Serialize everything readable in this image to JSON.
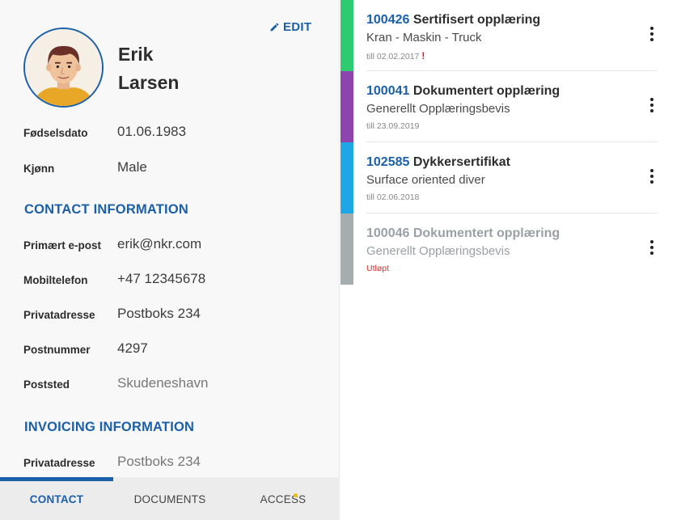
{
  "profile": {
    "edit_label": "EDIT",
    "first_name": "Erik",
    "last_name": "Larsen",
    "fields": [
      {
        "label": "Fødselsdato",
        "value": "01.06.1983"
      },
      {
        "label": "Kjønn",
        "value": "Male"
      }
    ]
  },
  "contact": {
    "heading": "CONTACT INFORMATION",
    "fields": [
      {
        "label": "Primært e-post",
        "value": "erik@nkr.com"
      },
      {
        "label": "Mobiltelefon",
        "value": "+47 12345678"
      },
      {
        "label": "Privatadresse",
        "value": "Postboks 234"
      },
      {
        "label": "Postnummer",
        "value": "4297"
      },
      {
        "label": "Poststed",
        "value": "Skudeneshavn"
      }
    ]
  },
  "invoicing": {
    "heading": "INVOICING INFORMATION",
    "fields": [
      {
        "label": "Privatadresse",
        "value": "Postboks 234"
      }
    ]
  },
  "tabs": [
    {
      "label": "CONTACT",
      "active": true
    },
    {
      "label": "DOCUMENTS",
      "active": false
    },
    {
      "label": "ACCESS",
      "active": false,
      "has_notification": true
    }
  ],
  "documents": [
    {
      "number": "100426",
      "title": "Sertifisert opplæring",
      "subtitle": "Kran - Maskin - Truck",
      "date": "till 02.02.2017",
      "warning": "!",
      "color": "#2ecc71"
    },
    {
      "number": "100041",
      "title": "Dokumentert opplæring",
      "subtitle": "Generellt Opplæringsbevis",
      "date": "till 23.09.2019",
      "color": "#8e44ad"
    },
    {
      "number": "102585",
      "title": "Dykkersertifikat",
      "subtitle": "Surface oriented diver",
      "date": "till 02.06.2018",
      "color": "#1ea7e4"
    },
    {
      "number": "100046",
      "title": "Dokumentert opplæring",
      "subtitle": "Generellt Opplæringsbevis",
      "date": "Utløpt",
      "color": "#a5adb0",
      "expired": true
    }
  ],
  "colors": {
    "accent": "#1a5fa8",
    "warning": "#dd1111"
  }
}
